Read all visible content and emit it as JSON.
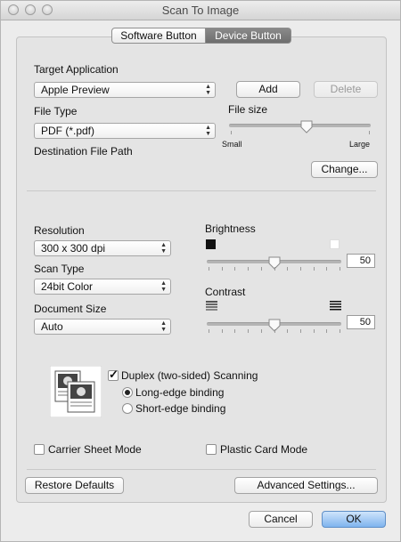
{
  "window": {
    "title": "Scan To Image"
  },
  "tabs": [
    {
      "label": "Software Button",
      "selected": false
    },
    {
      "label": "Device Button",
      "selected": true
    }
  ],
  "target_app": {
    "label": "Target Application",
    "value": "Apple Preview",
    "add_label": "Add",
    "delete_label": "Delete"
  },
  "file_type": {
    "label": "File Type",
    "value": "PDF (*.pdf)"
  },
  "file_size": {
    "label": "File size",
    "min_label": "Small",
    "max_label": "Large",
    "level": 0.55
  },
  "destination": {
    "label": "Destination File Path",
    "change_label": "Change..."
  },
  "resolution": {
    "label": "Resolution",
    "value": "300 x 300 dpi"
  },
  "scan_type": {
    "label": "Scan Type",
    "value": "24bit Color"
  },
  "document_size": {
    "label": "Document Size",
    "value": "Auto"
  },
  "brightness": {
    "label": "Brightness",
    "value": "50",
    "level": 0.5
  },
  "contrast": {
    "label": "Contrast",
    "value": "50",
    "level": 0.5
  },
  "duplex": {
    "label": "Duplex (two-sided) Scanning",
    "checked": true,
    "long_edge": "Long-edge binding",
    "short_edge": "Short-edge binding",
    "selected": "long"
  },
  "carrier_sheet": {
    "label": "Carrier Sheet Mode",
    "checked": false
  },
  "plastic_card": {
    "label": "Plastic Card Mode",
    "checked": false
  },
  "buttons": {
    "restore": "Restore Defaults",
    "advanced": "Advanced Settings...",
    "cancel": "Cancel",
    "ok": "OK"
  }
}
